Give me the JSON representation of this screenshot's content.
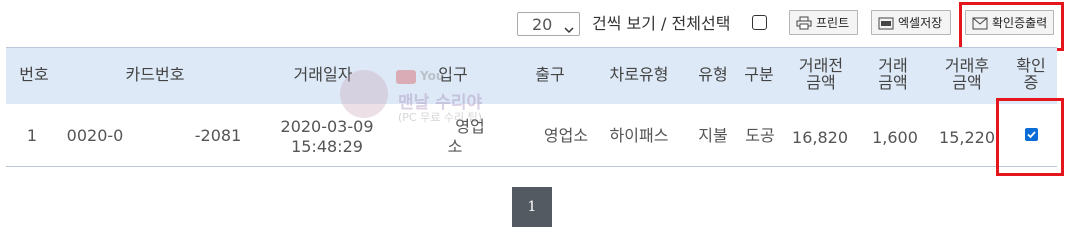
{
  "toolbar": {
    "page_size": "20",
    "bulk_label": "건씩 보기 / 전체선택",
    "print_label": "프린트",
    "excel_label": "엑셀저장",
    "receipt_label": "확인증출력"
  },
  "table": {
    "headers": {
      "no": "번호",
      "card": "카드번호",
      "date": "거래일자",
      "entry": "입구",
      "exit": "출구",
      "lane": "차로유형",
      "type": "유형",
      "class": "구분",
      "before_l1": "거래전",
      "before_l2": "금액",
      "amount_l1": "거래",
      "amount_l2": "금액",
      "after_l1": "거래후",
      "after_l2": "금액",
      "confirm_l1": "확인",
      "confirm_l2": "증"
    },
    "row": {
      "no": "1",
      "card_a": "0020-0",
      "card_b": "-2081",
      "date": "2020-03-09",
      "time": "15:48:29",
      "entry_l1": "영업",
      "entry_l2": "소",
      "exit": "영업소",
      "lane": "하이패스",
      "type": "지불",
      "class": "도공",
      "before": "16,820",
      "amount": "1,600",
      "after": "15,220",
      "checked": true
    }
  },
  "pagination": {
    "current": "1"
  },
  "watermark": {
    "yt": "You",
    "main": "맨날 수리야",
    "sub": "(PC 무료 수리 팁)"
  }
}
